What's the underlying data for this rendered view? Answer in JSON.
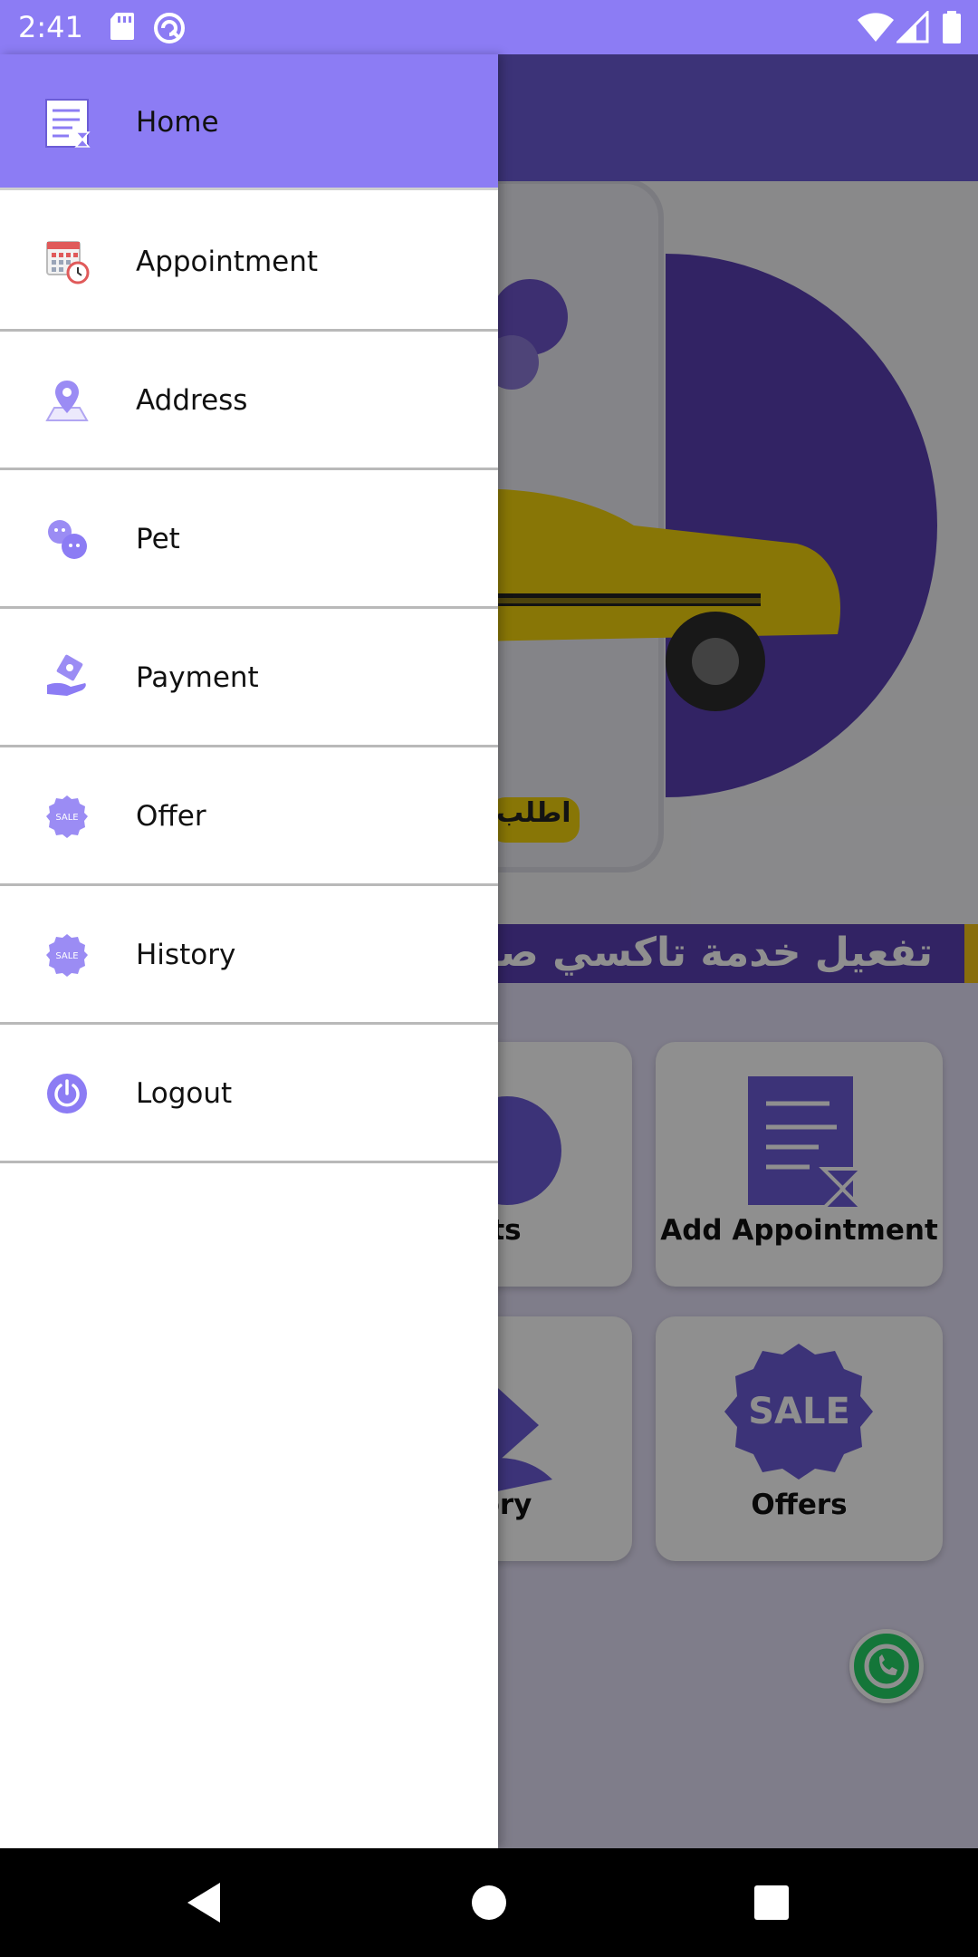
{
  "status_bar": {
    "time": "2:41",
    "icons": [
      "sd-card-icon",
      "sync-icon",
      "wifi-icon",
      "cell-signal-icon",
      "battery-icon"
    ],
    "color": "#8c7cf4"
  },
  "drawer": {
    "header": {
      "label": "Home",
      "icon": "document-icon",
      "color": "#8c7cf4"
    },
    "items": [
      {
        "label": "Appointment",
        "icon": "calendar-clock-icon"
      },
      {
        "label": "Address",
        "icon": "location-pin-icon"
      },
      {
        "label": "Pet",
        "icon": "pets-icon"
      },
      {
        "label": "Payment",
        "icon": "payment-hand-icon"
      },
      {
        "label": "Offer",
        "icon": "sale-badge-icon"
      },
      {
        "label": "History",
        "icon": "sale-badge-icon"
      },
      {
        "label": "Logout",
        "icon": "power-icon"
      }
    ]
  },
  "background": {
    "banner_text": "تفعيل خدمة تاكسي صد",
    "banner_button_text": "اطلب",
    "cards": [
      {
        "label": "ts"
      },
      {
        "label": "Add Appointment"
      },
      {
        "label": "ory"
      },
      {
        "label": "Offers"
      }
    ],
    "sale_text": "SALE",
    "accent": "#6b5cd6"
  },
  "nav_bar": {
    "buttons": [
      "back-icon",
      "home-icon",
      "recents-icon"
    ]
  }
}
